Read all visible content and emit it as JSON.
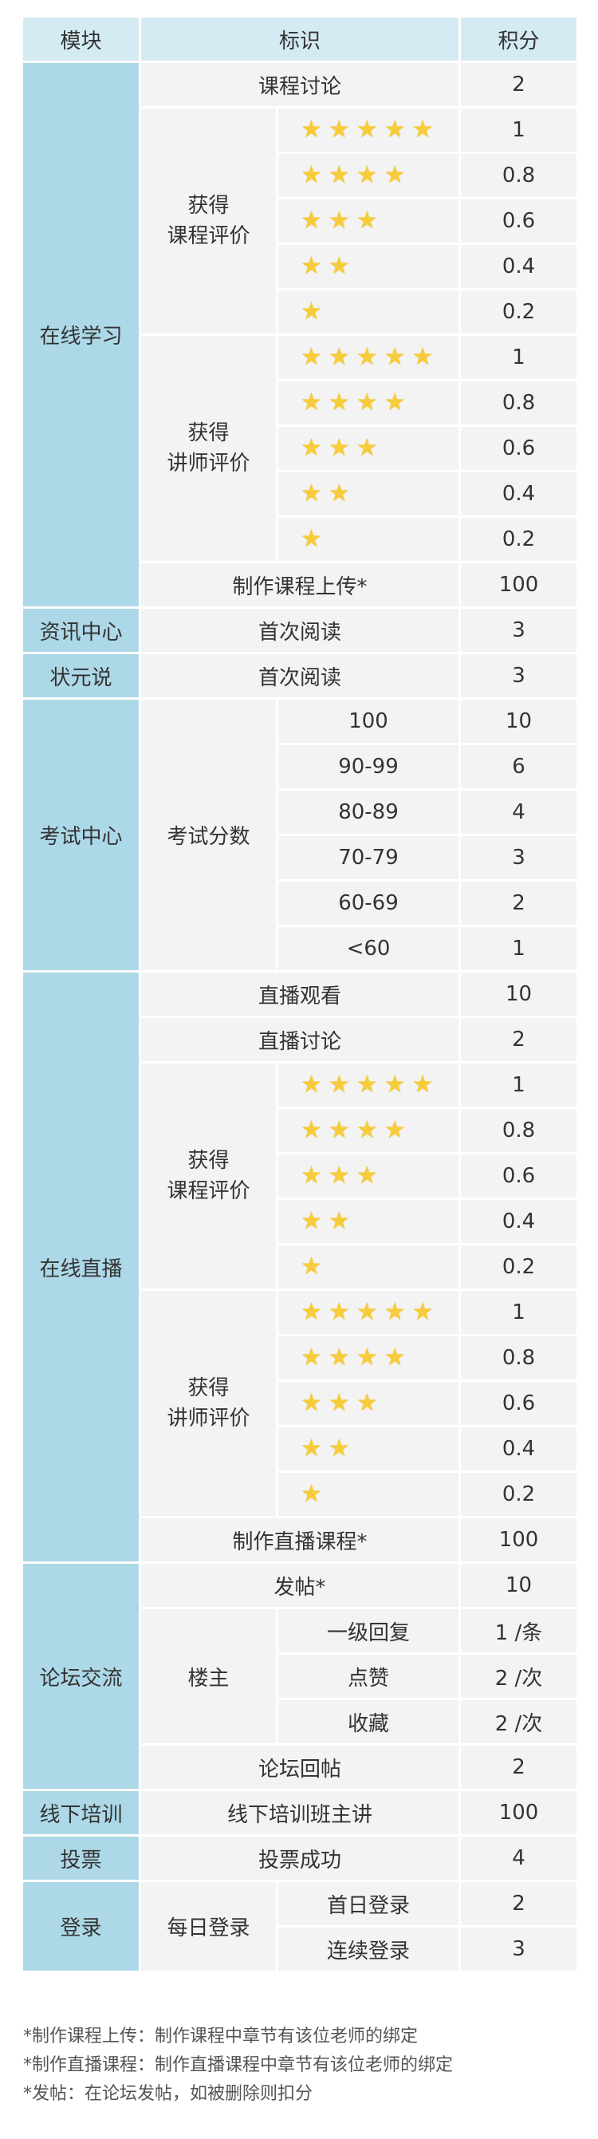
{
  "header": {
    "col1": "模块",
    "col2": "标识",
    "col3": "积分"
  },
  "online_learning": {
    "module": "在线学习",
    "discussion": {
      "label": "课程讨论",
      "points": "2"
    },
    "course_rating": {
      "label": "获得\n课程评价",
      "points": [
        "1",
        "0.8",
        "0.6",
        "0.4",
        "0.2"
      ]
    },
    "teacher_rating": {
      "label": "获得\n讲师评价",
      "points": [
        "1",
        "0.8",
        "0.6",
        "0.4",
        "0.2"
      ]
    },
    "upload": {
      "label": "制作课程上传*",
      "points": "100"
    }
  },
  "news": {
    "module": "资讯中心",
    "label": "首次阅读",
    "points": "3"
  },
  "zhuangyuan": {
    "module": "状元说",
    "label": "首次阅读",
    "points": "3"
  },
  "exam": {
    "module": "考试中心",
    "label": "考试分数",
    "rows": [
      {
        "range": "100",
        "points": "10"
      },
      {
        "range": "90-99",
        "points": "6"
      },
      {
        "range": "80-89",
        "points": "4"
      },
      {
        "range": "70-79",
        "points": "3"
      },
      {
        "range": "60-69",
        "points": "2"
      },
      {
        "range": "<60",
        "points": "1"
      }
    ]
  },
  "live": {
    "module": "在线直播",
    "watch": {
      "label": "直播观看",
      "points": "10"
    },
    "discuss": {
      "label": "直播讨论",
      "points": "2"
    },
    "course_rating": {
      "label": "获得\n课程评价",
      "points": [
        "1",
        "0.8",
        "0.6",
        "0.4",
        "0.2"
      ]
    },
    "teacher_rating": {
      "label": "获得\n讲师评价",
      "points": [
        "1",
        "0.8",
        "0.6",
        "0.4",
        "0.2"
      ]
    },
    "make": {
      "label": "制作直播课程*",
      "points": "100"
    }
  },
  "forum": {
    "module": "论坛交流",
    "post": {
      "label": "发帖*",
      "points": "10"
    },
    "owner": {
      "label": "楼主",
      "rows": [
        {
          "label": "一级回复",
          "points": "1 /条"
        },
        {
          "label": "点赞",
          "points": "2 /次"
        },
        {
          "label": "收藏",
          "points": "2 /次"
        }
      ]
    },
    "reply": {
      "label": "论坛回帖",
      "points": "2"
    }
  },
  "offline": {
    "module": "线下培训",
    "label": "线下培训班主讲",
    "points": "100"
  },
  "vote": {
    "module": "投票",
    "label": "投票成功",
    "points": "4"
  },
  "login": {
    "module": "登录",
    "label": "每日登录",
    "rows": [
      {
        "label": "首日登录",
        "points": "2"
      },
      {
        "label": "连续登录",
        "points": "3"
      }
    ]
  },
  "notes": [
    "*制作课程上传：制作课程中章节有该位老师的绑定",
    "*制作直播课程：制作直播课程中章节有该位老师的绑定",
    "*发帖：在论坛发帖，如被删除则扣分"
  ],
  "star_color": "#f7cc3a",
  "star_counts": [
    5,
    4,
    3,
    2,
    1
  ]
}
